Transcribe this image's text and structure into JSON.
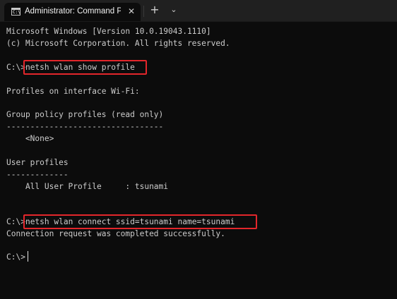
{
  "tab": {
    "icon_glyph": "C:\\",
    "title": "Administrator: Command Promp",
    "close_glyph": "✕",
    "new_tab_glyph": "+",
    "dropdown_glyph": "⌄"
  },
  "console": {
    "version_line": "Microsoft Windows [Version 10.0.19043.1110]",
    "copyright_line": "(c) Microsoft Corporation. All rights reserved.",
    "prompt1": "C:\\>",
    "cmd1": "netsh wlan show profile",
    "profiles_header": "Profiles on interface Wi-Fi:",
    "group_policy_header": "Group policy profiles (read only)",
    "group_policy_divider": "---------------------------------",
    "group_policy_value": "    <None>",
    "user_profiles_header": "User profiles",
    "user_profiles_divider": "-------------",
    "user_profile_entry": "    All User Profile     : tsunami",
    "prompt2": "C:\\>",
    "cmd2": "netsh wlan connect ssid=tsunami name=tsunami",
    "connect_result": "Connection request was completed successfully.",
    "prompt3": "C:\\>"
  },
  "colors": {
    "background": "#0c0c0c",
    "text": "#cccccc",
    "highlight": "#e3262b",
    "tabbar": "#202020"
  }
}
